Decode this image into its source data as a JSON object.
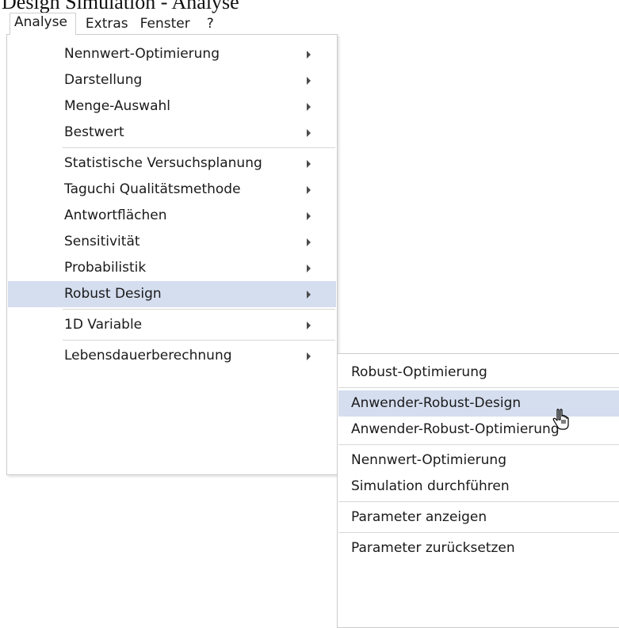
{
  "caption_cutoff": "Design Simulation - Analyse",
  "menubar": {
    "items": [
      "Analyse",
      "Extras",
      "Fenster",
      "?"
    ]
  },
  "analyse_menu": {
    "items": [
      "Nennwert-Optimierung",
      "Darstellung",
      "Menge-Auswahl",
      "Bestwert",
      "Statistische Versuchsplanung",
      "Taguchi Qualitätsmethode",
      "Antwortflächen",
      "Sensitivität",
      "Probabilistik",
      "Robust Design",
      "1D Variable",
      "Lebensdauerberechnung"
    ],
    "highlighted": "Robust Design"
  },
  "robust_design_submenu": {
    "items": [
      "Robust-Optimierung",
      "Anwender-Robust-Design",
      "Anwender-Robust-Optimierung",
      "Nennwert-Optimierung",
      "Simulation durchführen",
      "Parameter anzeigen",
      "Parameter zurücksetzen"
    ],
    "highlighted": "Anwender-Robust-Design"
  },
  "colors": {
    "highlight": "#d5deef",
    "separator": "#d8d8d8",
    "border": "#cccccc"
  },
  "icons": {
    "submenu_arrow": "triangle-right",
    "cursor": "hand-pointer"
  }
}
